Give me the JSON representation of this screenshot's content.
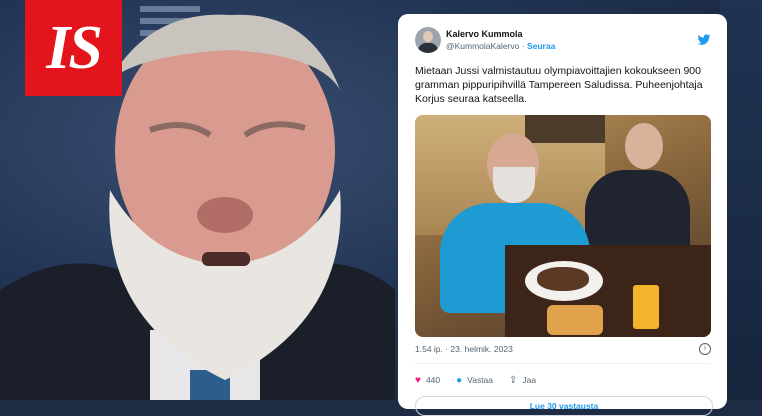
{
  "branding": {
    "logo_text": "IS",
    "logo_color": "#e3141c"
  },
  "tweet": {
    "author_name": "Kalervo Kummola",
    "author_handle": "@KummolaKalervo",
    "separator": "·",
    "follow_label": "Seuraa",
    "text": "Mietaan Jussi valmistautuu olympiavoittajien kokoukseen 900 gramman pippuripihvillä Tampereen Saludissa. Puheenjohtaja Korjus seuraa katseella.",
    "timestamp": "1.54 ip. · 23. helmik. 2023",
    "likes_count": "440",
    "reply_label": "Vastaa",
    "share_label": "Jaa",
    "read_replies_label": "Lue 30 vastausta",
    "accent_color": "#1d9bf0"
  },
  "icons": [
    "twitter-bird-icon",
    "info-icon",
    "heart-icon",
    "reply-bubble-icon",
    "share-icon"
  ]
}
